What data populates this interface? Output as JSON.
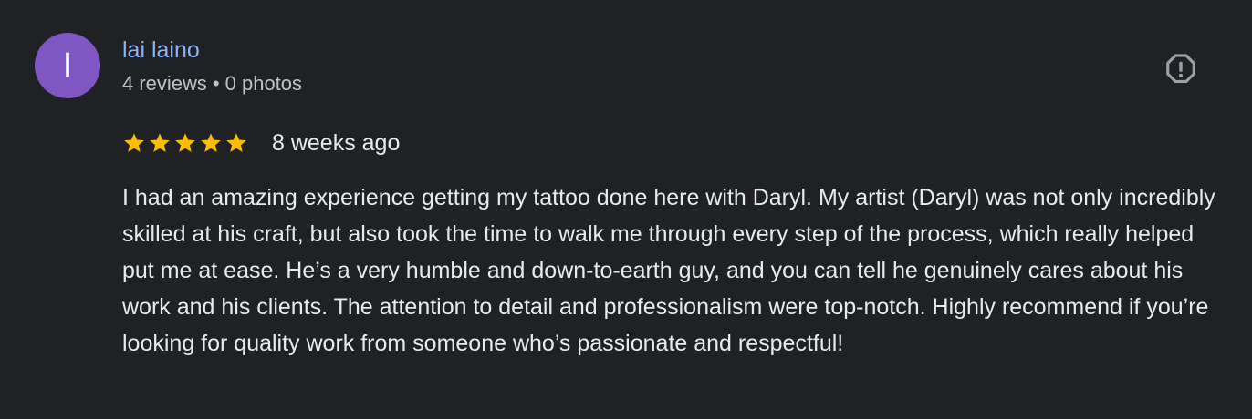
{
  "colors": {
    "avatar_bg": "#7e57c2",
    "name_link": "#8ab4f8",
    "star": "#fbbc04",
    "text": "#e8eaed",
    "secondary_text": "#bdc1c6",
    "icon": "#9aa0a6",
    "background": "#202124"
  },
  "review": {
    "avatar": {
      "letter": "I"
    },
    "reviewer": {
      "name": "lai laino",
      "reviews_count": "4 reviews",
      "separator": "•",
      "photos_count": "0 photos"
    },
    "report_icon": "report-flag-octagon-icon",
    "rating": {
      "stars": 5,
      "max": 5,
      "icon": "star-icon"
    },
    "date": "8 weeks ago",
    "text": "I had an amazing experience getting my tattoo done here with Daryl. My artist (Daryl) was not only incredibly skilled at his craft, but also took the time to walk me through every step of the process, which really helped put me at ease. He’s a very humble and down-to-earth guy, and you can tell he genuinely cares about his work and his clients. The attention to detail and professionalism were top-notch. Highly recommend if you’re looking for quality work from someone who’s passionate and respectful!"
  }
}
